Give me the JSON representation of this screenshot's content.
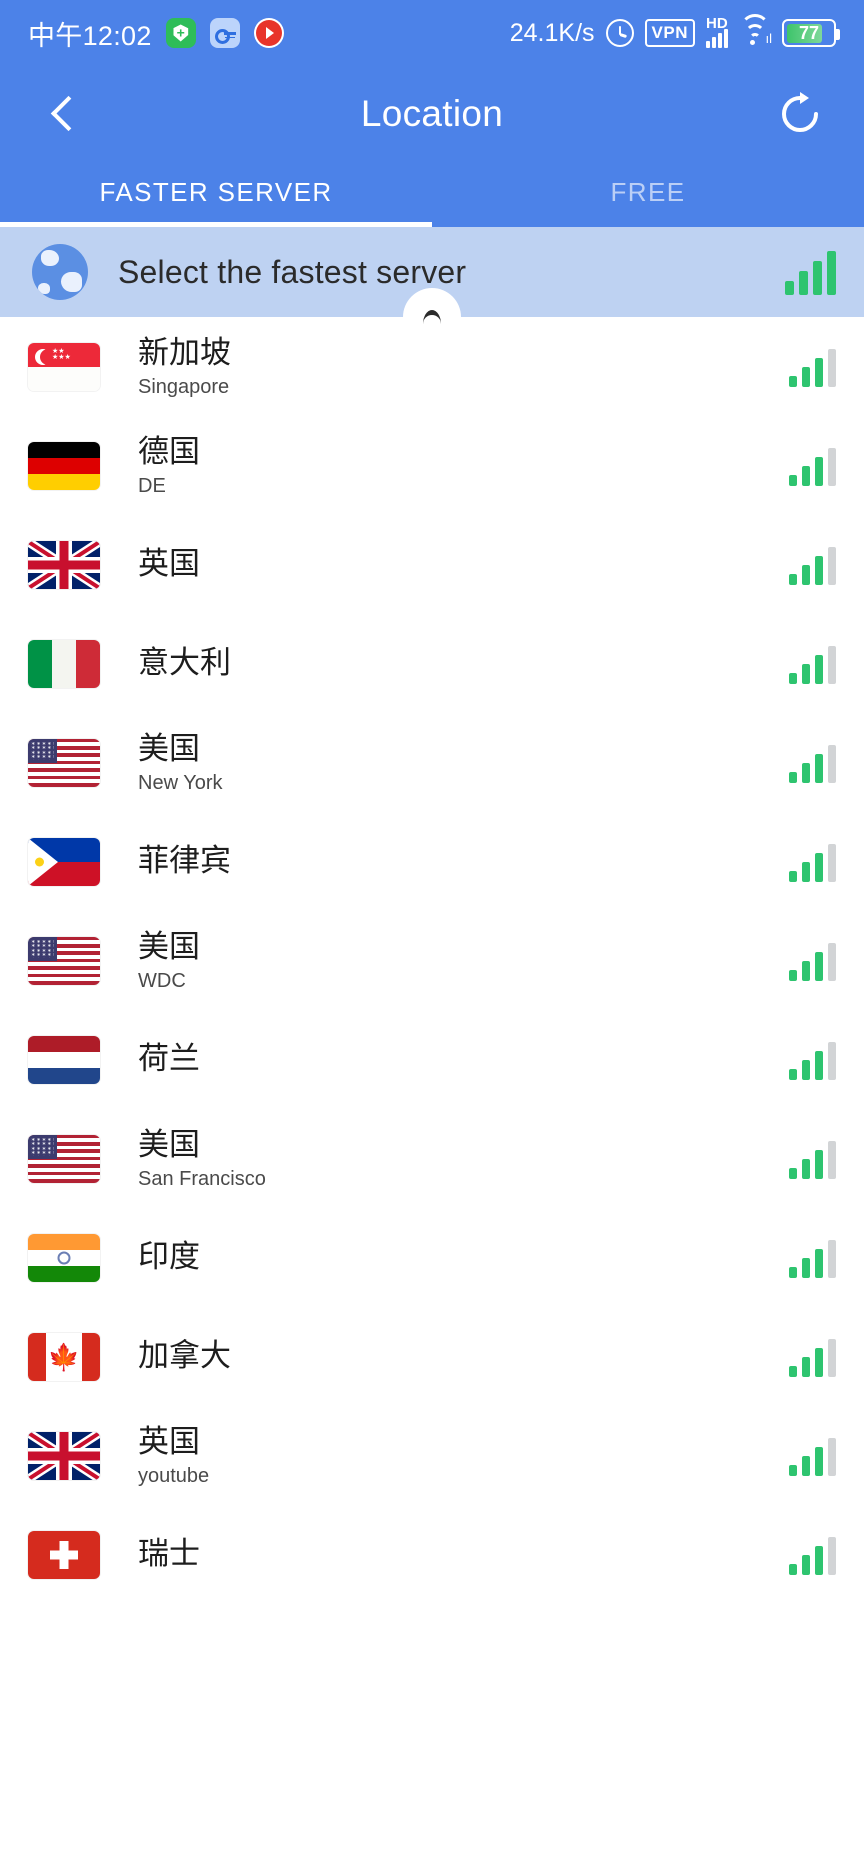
{
  "status_bar": {
    "clock": "中午12:02",
    "network_speed": "24.1K/s",
    "vpn_label": "VPN",
    "hd_label": "HD",
    "battery_percent": "77",
    "icons": [
      "shield-app-icon",
      "key-app-icon",
      "media-player-app-icon",
      "alarm-icon",
      "vpn-icon",
      "signal-icon",
      "wifi-icon",
      "battery-icon"
    ]
  },
  "header": {
    "title": "Location",
    "back_icon": "chevron-left-icon",
    "refresh_icon": "refresh-icon"
  },
  "tabs": [
    {
      "label": "FASTER SERVER",
      "active": true
    },
    {
      "label": "FREE",
      "active": false
    }
  ],
  "fastest_server": {
    "label": "Select the fastest server",
    "icon": "globe-icon",
    "signal_bars": 4,
    "signal_total": 4,
    "collapse_icon": "chevron-up-icon"
  },
  "servers": [
    {
      "flag": "sg",
      "name": "新加坡",
      "city": "Singapore",
      "bars": 3
    },
    {
      "flag": "de",
      "name": "德国",
      "city": "DE",
      "bars": 3
    },
    {
      "flag": "uk",
      "name": "英国",
      "city": "",
      "bars": 3
    },
    {
      "flag": "it",
      "name": "意大利",
      "city": "",
      "bars": 3
    },
    {
      "flag": "us",
      "name": "美国",
      "city": "New York",
      "bars": 3
    },
    {
      "flag": "ph",
      "name": "菲律宾",
      "city": "",
      "bars": 3
    },
    {
      "flag": "us",
      "name": "美国",
      "city": "WDC",
      "bars": 3
    },
    {
      "flag": "nl",
      "name": "荷兰",
      "city": "",
      "bars": 3
    },
    {
      "flag": "us",
      "name": "美国",
      "city": "San Francisco",
      "bars": 3
    },
    {
      "flag": "in",
      "name": "印度",
      "city": "",
      "bars": 3
    },
    {
      "flag": "ca",
      "name": "加拿大",
      "city": "",
      "bars": 3
    },
    {
      "flag": "uk",
      "name": "英国",
      "city": "youtube",
      "bars": 3
    },
    {
      "flag": "ch",
      "name": "瑞士",
      "city": "",
      "bars": 3
    }
  ],
  "colors": {
    "header_blue": "#4c82e8",
    "banner_blue": "#bed2f2",
    "signal_green": "#2ec46f",
    "signal_gray": "#d2d4d6"
  }
}
